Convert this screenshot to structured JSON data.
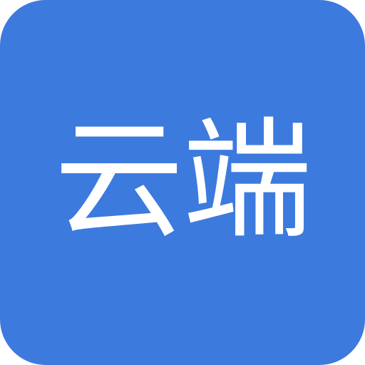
{
  "app_icon": {
    "label": "云端",
    "background_color": "#3d7ade",
    "text_color": "#ffffff"
  }
}
